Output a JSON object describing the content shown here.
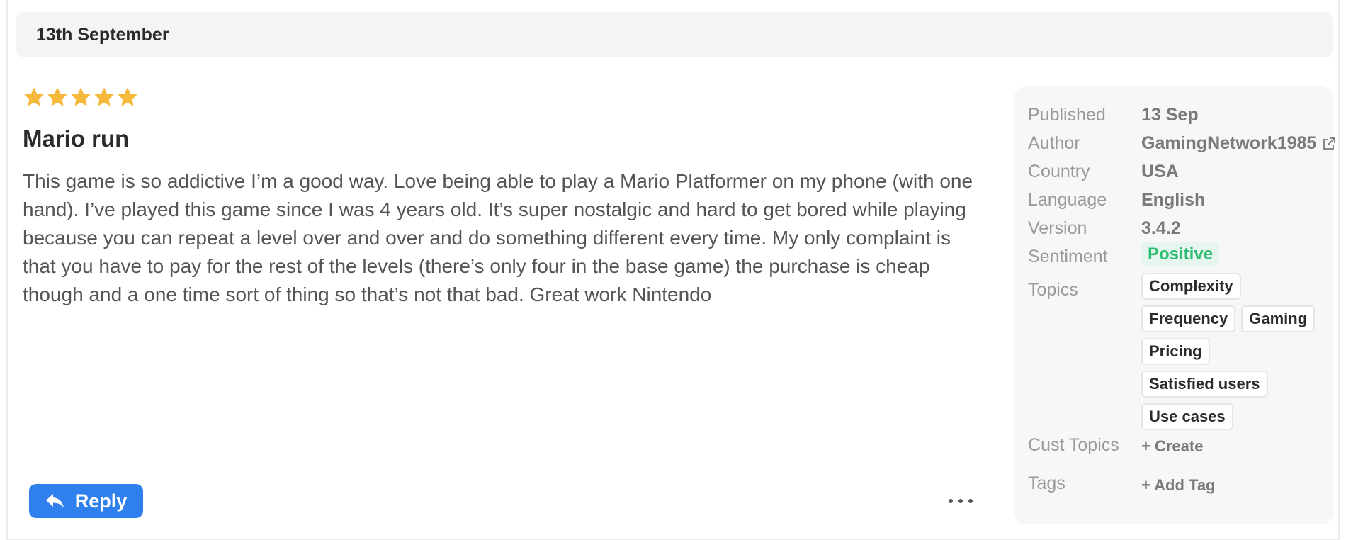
{
  "date_header": "13th September",
  "review": {
    "rating": 5,
    "title": "Mario run",
    "body": "This game is so addictive I’m a good way. Love being able to play a Mario Platformer on my phone (with one hand). I’ve played this game since I was 4 years old. It’s super nostalgic and hard to get bored while playing because you can repeat a level over and over and do something different every time. My only complaint is that you have to pay for the rest of the levels (there’s only four in the base game) the purchase is cheap though and a one time sort of thing so that’s not that bad. Great work Nintendo"
  },
  "actions": {
    "reply_label": "Reply",
    "more_icon": "more-horizontal-icon"
  },
  "meta": {
    "published_label": "Published",
    "published_value": "13 Sep",
    "author_label": "Author",
    "author_value": "GamingNetwork1985",
    "country_label": "Country",
    "country_value": "USA",
    "language_label": "Language",
    "language_value": "English",
    "version_label": "Version",
    "version_value": "3.4.2",
    "sentiment_label": "Sentiment",
    "sentiment_value": "Positive",
    "topics_label": "Topics",
    "topics": [
      "Complexity",
      "Frequency",
      "Gaming",
      "Pricing",
      "Satisfied users",
      "Use cases"
    ],
    "cust_topics_label": "Cust Topics",
    "cust_topics_action": "+ Create",
    "tags_label": "Tags",
    "tags_action": "+ Add Tag"
  },
  "colors": {
    "star": "#f6b93b",
    "reply_button": "#2f80ed",
    "sentiment_positive": "#2ebd72"
  }
}
